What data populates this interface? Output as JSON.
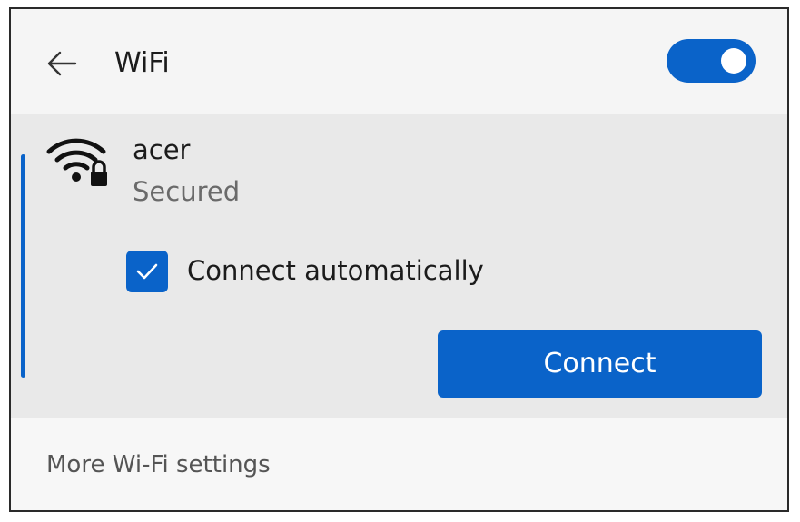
{
  "header": {
    "title": "WiFi",
    "back_icon": "arrow-left-icon",
    "wifi_toggle_on": true
  },
  "network": {
    "name": "acer",
    "status": "Secured",
    "icon": "wifi-secured-icon",
    "connect_automatically": {
      "label": "Connect automatically",
      "checked": true
    },
    "connect_label": "Connect"
  },
  "footer": {
    "more_settings_label": "More Wi-Fi settings"
  },
  "colors": {
    "accent": "#0a63c9",
    "panel_bg": "#f7f7f7",
    "card_bg": "#e9e9e9"
  }
}
